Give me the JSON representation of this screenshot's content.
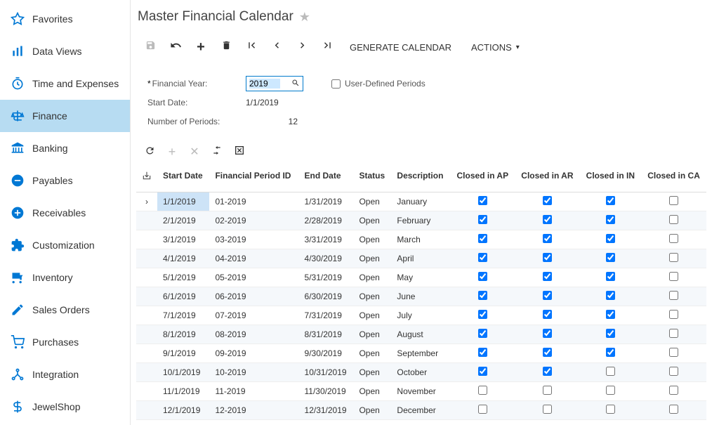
{
  "page_title": "Master Financial Calendar",
  "sidebar": {
    "items": [
      {
        "name": "favorites",
        "label": "Favorites"
      },
      {
        "name": "data-views",
        "label": "Data Views"
      },
      {
        "name": "time-expenses",
        "label": "Time and Expenses"
      },
      {
        "name": "finance",
        "label": "Finance",
        "active": true
      },
      {
        "name": "banking",
        "label": "Banking"
      },
      {
        "name": "payables",
        "label": "Payables"
      },
      {
        "name": "receivables",
        "label": "Receivables"
      },
      {
        "name": "customization",
        "label": "Customization"
      },
      {
        "name": "inventory",
        "label": "Inventory"
      },
      {
        "name": "sales-orders",
        "label": "Sales Orders"
      },
      {
        "name": "purchases",
        "label": "Purchases"
      },
      {
        "name": "integration",
        "label": "Integration"
      },
      {
        "name": "jewelshop",
        "label": "JewelShop"
      }
    ]
  },
  "toolbar": {
    "generate_label": "GENERATE CALENDAR",
    "actions_label": "ACTIONS"
  },
  "header": {
    "financial_year_label": "Financial Year:",
    "financial_year_value": "2019",
    "start_date_label": "Start Date:",
    "start_date_value": "1/1/2019",
    "num_periods_label": "Number of Periods:",
    "num_periods_value": "12",
    "user_defined_periods_label": "User-Defined Periods",
    "user_defined_periods_checked": false
  },
  "grid": {
    "columns": {
      "start_date": "Start Date",
      "period_id": "Financial Period ID",
      "end_date": "End Date",
      "status": "Status",
      "description": "Description",
      "closed_ap": "Closed in AP",
      "closed_ar": "Closed in AR",
      "closed_in": "Closed in IN",
      "closed_ca": "Closed in CA"
    },
    "rows": [
      {
        "start": "1/1/2019",
        "pid": "01-2019",
        "end": "1/31/2019",
        "status": "Open",
        "desc": "January",
        "ap": true,
        "ar": true,
        "in_": true,
        "ca": false,
        "selected": true
      },
      {
        "start": "2/1/2019",
        "pid": "02-2019",
        "end": "2/28/2019",
        "status": "Open",
        "desc": "February",
        "ap": true,
        "ar": true,
        "in_": true,
        "ca": false
      },
      {
        "start": "3/1/2019",
        "pid": "03-2019",
        "end": "3/31/2019",
        "status": "Open",
        "desc": "March",
        "ap": true,
        "ar": true,
        "in_": true,
        "ca": false
      },
      {
        "start": "4/1/2019",
        "pid": "04-2019",
        "end": "4/30/2019",
        "status": "Open",
        "desc": "April",
        "ap": true,
        "ar": true,
        "in_": true,
        "ca": false
      },
      {
        "start": "5/1/2019",
        "pid": "05-2019",
        "end": "5/31/2019",
        "status": "Open",
        "desc": "May",
        "ap": true,
        "ar": true,
        "in_": true,
        "ca": false
      },
      {
        "start": "6/1/2019",
        "pid": "06-2019",
        "end": "6/30/2019",
        "status": "Open",
        "desc": "June",
        "ap": true,
        "ar": true,
        "in_": true,
        "ca": false
      },
      {
        "start": "7/1/2019",
        "pid": "07-2019",
        "end": "7/31/2019",
        "status": "Open",
        "desc": "July",
        "ap": true,
        "ar": true,
        "in_": true,
        "ca": false
      },
      {
        "start": "8/1/2019",
        "pid": "08-2019",
        "end": "8/31/2019",
        "status": "Open",
        "desc": "August",
        "ap": true,
        "ar": true,
        "in_": true,
        "ca": false
      },
      {
        "start": "9/1/2019",
        "pid": "09-2019",
        "end": "9/30/2019",
        "status": "Open",
        "desc": "September",
        "ap": true,
        "ar": true,
        "in_": true,
        "ca": false
      },
      {
        "start": "10/1/2019",
        "pid": "10-2019",
        "end": "10/31/2019",
        "status": "Open",
        "desc": "October",
        "ap": true,
        "ar": true,
        "in_": false,
        "ca": false
      },
      {
        "start": "11/1/2019",
        "pid": "11-2019",
        "end": "11/30/2019",
        "status": "Open",
        "desc": "November",
        "ap": false,
        "ar": false,
        "in_": false,
        "ca": false
      },
      {
        "start": "12/1/2019",
        "pid": "12-2019",
        "end": "12/31/2019",
        "status": "Open",
        "desc": "December",
        "ap": false,
        "ar": false,
        "in_": false,
        "ca": false
      }
    ]
  }
}
